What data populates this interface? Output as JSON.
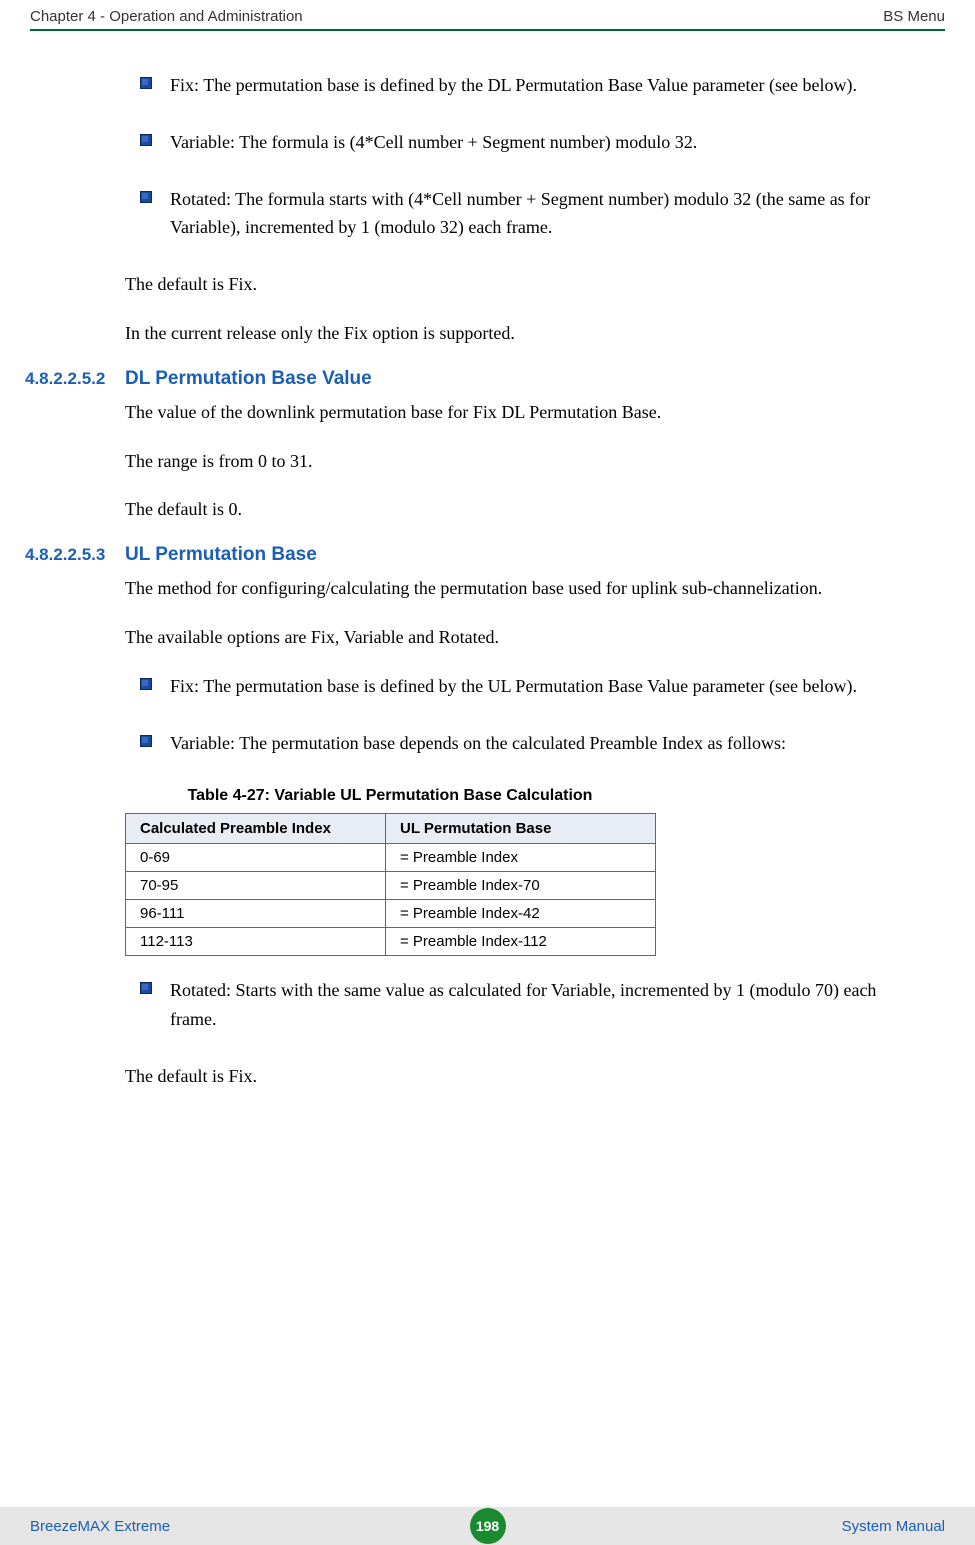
{
  "header": {
    "left": "Chapter 4 - Operation and Administration",
    "right": "BS Menu"
  },
  "bullets_top": [
    "Fix: The permutation base is defined by the DL Permutation Base Value parameter (see below).",
    "Variable: The formula is (4*Cell number + Segment number) modulo 32.",
    "Rotated: The formula starts with (4*Cell number + Segment number) modulo 32 (the same as for Variable), incremented by 1 (modulo 32) each frame."
  ],
  "paras_after_top": [
    "The default is Fix.",
    "In the current release only the Fix option is supported."
  ],
  "section1": {
    "num": "4.8.2.2.5.2",
    "title": "DL Permutation Base Value",
    "paras": [
      "The value of the downlink permutation base for Fix DL Permutation Base.",
      "The range is from 0 to 31.",
      "The default is 0."
    ]
  },
  "section2": {
    "num": "4.8.2.2.5.3",
    "title": "UL Permutation Base",
    "paras_before": [
      "The method for configuring/calculating the permutation base used for uplink sub-channelization.",
      "The available options are Fix, Variable and Rotated."
    ],
    "bullets": [
      "Fix: The permutation base is defined by the UL Permutation Base Value parameter (see below).",
      "Variable: The permutation base depends on the calculated Preamble Index as follows:"
    ],
    "bullet_rotated": "Rotated: Starts with the same value as calculated for Variable, incremented by 1 (modulo 70) each frame.",
    "para_after": "The default is Fix."
  },
  "table": {
    "caption": "Table 4-27: Variable UL Permutation Base Calculation",
    "headers": [
      "Calculated Preamble Index",
      "UL Permutation Base"
    ],
    "rows": [
      [
        "0-69",
        "= Preamble Index"
      ],
      [
        "70-95",
        "= Preamble Index-70"
      ],
      [
        "96-111",
        "= Preamble Index-42"
      ],
      [
        "112-113",
        "= Preamble Index-112"
      ]
    ]
  },
  "footer": {
    "left": "BreezeMAX Extreme",
    "page": "198",
    "right": "System Manual"
  }
}
